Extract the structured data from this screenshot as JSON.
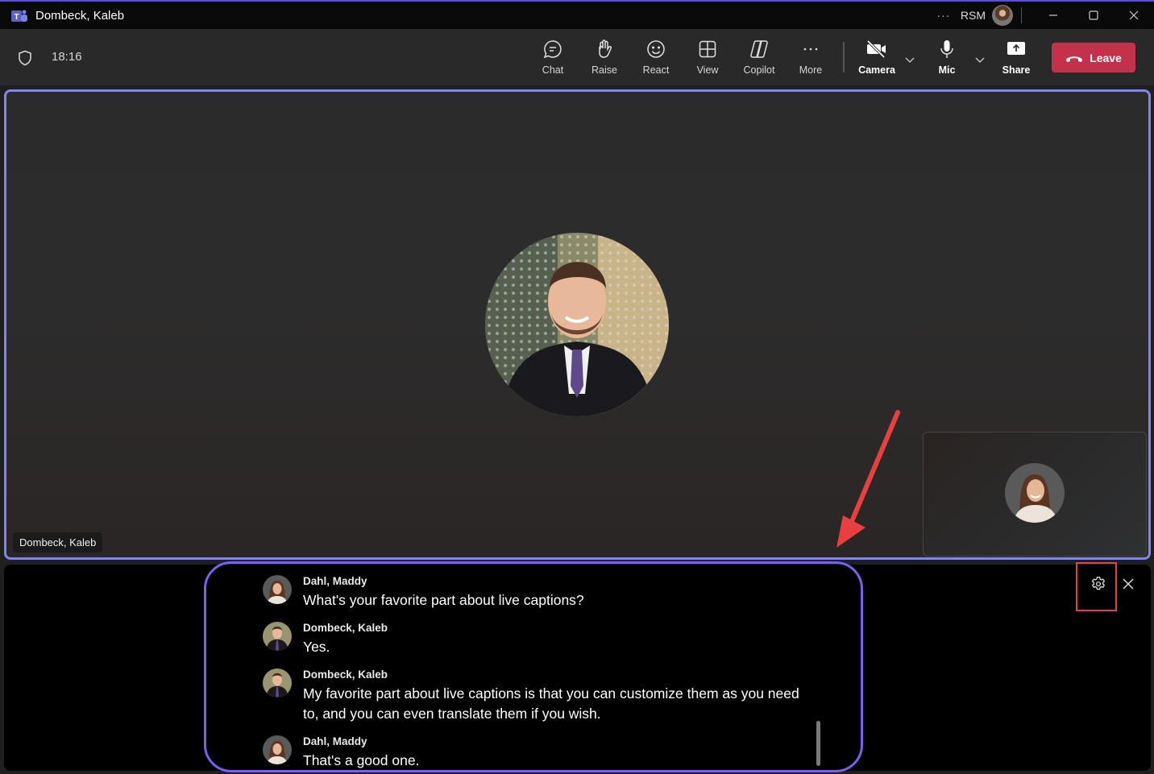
{
  "window": {
    "title": "Dombeck, Kaleb",
    "org": "RSM",
    "more_icon": "ellipsis-icon"
  },
  "meeting": {
    "timer": "18:16"
  },
  "toolbar": {
    "chat": "Chat",
    "raise": "Raise",
    "react": "React",
    "view": "View",
    "copilot": "Copilot",
    "more": "More",
    "camera": "Camera",
    "mic": "Mic",
    "share": "Share",
    "leave": "Leave"
  },
  "stage": {
    "speaker_name": "Dombeck, Kaleb"
  },
  "captions": {
    "entries": [
      {
        "speaker": "Dahl, Maddy",
        "text": "What's your favorite part about live captions?"
      },
      {
        "speaker": "Dombeck, Kaleb",
        "text": "Yes."
      },
      {
        "speaker": "Dombeck, Kaleb",
        "text": "My favorite part about live captions is that you can customize them as you need to, and you can even translate them if you wish."
      },
      {
        "speaker": "Dahl, Maddy",
        "text": "That's a good one."
      }
    ]
  },
  "colors": {
    "accent": "#7f85f5",
    "leave": "#c4314b",
    "annotation": "#e84040",
    "caption_frame": "#7a5ff0"
  }
}
